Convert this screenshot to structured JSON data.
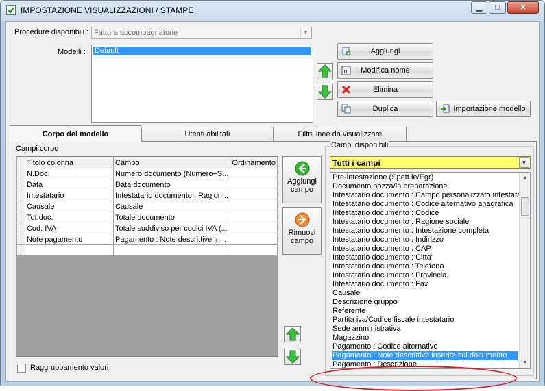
{
  "window": {
    "title": "IMPOSTAZIONE VISUALIZZAZIONI / STAMPE",
    "minimize_glyph": "▁",
    "maximize_glyph": "□",
    "close_glyph": "✕"
  },
  "top": {
    "procedure_label": "Procedure disponibili :",
    "procedure_value": "Fatture accompagnatorie",
    "models_label": "Modelli :",
    "models": [
      "Default"
    ],
    "buttons": {
      "add": "Aggiungi",
      "rename": "Modifica nome",
      "delete": "Elimina",
      "duplicate": "Duplica",
      "import": "Importazione modello"
    }
  },
  "tabs": [
    {
      "label": "Corpo del modello",
      "active": true
    },
    {
      "label": "Utenti abilitati",
      "active": false
    },
    {
      "label": "Filtri linee da visualizzare",
      "active": false
    }
  ],
  "body": {
    "fields_group_label": "Campi corpo",
    "columns": [
      "Titolo colonna",
      "Campo",
      "Ordinamento"
    ],
    "rows": [
      [
        "N.Doc.",
        "Numero documento (Numero+S...",
        ""
      ],
      [
        "Data",
        "Data documento",
        ""
      ],
      [
        "Intestatario",
        "Intestatario documento : Ragion...",
        ""
      ],
      [
        "Causale",
        "Causale",
        ""
      ],
      [
        "Tot.doc.",
        "Totale documento",
        ""
      ],
      [
        "Cod. IVA",
        "Totale suddiviso per codici IVA (...",
        ""
      ],
      [
        "Note pagamento",
        "Pagamento : Note descrittive in...",
        ""
      ],
      [
        "",
        "",
        ""
      ]
    ],
    "add_field_label": [
      "Aggiungi",
      "campo"
    ],
    "remove_field_label": [
      "Rimuovi",
      "campo"
    ],
    "grouping_label": "Raggruppamento valori",
    "grouping_checked": false
  },
  "available": {
    "group_label": "Campi disponibili",
    "filter_value": "Tutti i campi",
    "items": [
      "Pre-intestazione (Spett.le/Egr)",
      "Documento bozza/in preparazione",
      "Intestatario documento : Campo personalizzato intestatario",
      "Intestatario documento : Codice alternativo anagrafica",
      "Intestatario documento : Codice",
      "Intestatario documento : Ragione sociale",
      "Intestatario documento : Intestazione completa",
      "Intestatario documento : Indirizzo",
      "Intestatario documento : CAP",
      "Intestatario documento : Citta'",
      "Intestatario documento : Telefono",
      "Intestatario documento : Provincia",
      "Intestatario documento : Fax",
      "Causale",
      "Descrizione gruppo",
      "Referente",
      "Partita iva/Codice fiscale intestatario",
      "Sede amministrativa",
      "Magazzino",
      "Pagamento : Codice alternativo",
      "Pagamento : Note descrittive inserite sul documento",
      "Pagamento : Descrizione"
    ],
    "selected_index": 20
  },
  "colors": {
    "selection": "#3399ff",
    "filter_bg": "#ffff70",
    "highlight_ellipse": "#e0181b"
  },
  "icons": {
    "up_arrow": "green-up-arrow-icon",
    "down_arrow": "green-down-arrow-icon",
    "add_field": "green-left-arrow-icon",
    "remove_field": "orange-right-arrow-icon"
  }
}
